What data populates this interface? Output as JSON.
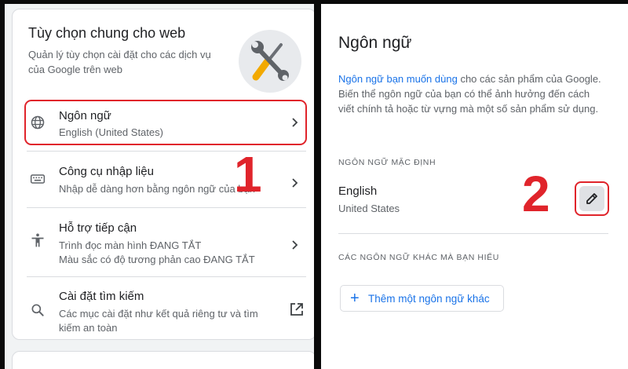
{
  "left": {
    "title": "Tùy chọn chung cho web",
    "subtitle": "Quản lý tùy chọn cài đặt cho các dịch vụ của Google trên web",
    "tools_icon": "wrench-screwdriver-icon",
    "items": [
      {
        "icon": "globe-icon",
        "title": "Ngôn ngữ",
        "desc": "English (United States)"
      },
      {
        "icon": "keyboard-icon",
        "title": "Công cụ nhập liệu",
        "desc": "Nhập dễ dàng hơn bằng ngôn ngữ của bạn"
      },
      {
        "icon": "accessibility-icon",
        "title": "Hỗ trợ tiếp cận",
        "desc": "Trình đọc màn hình ĐANG TẮT",
        "desc2": "Màu sắc có độ tương phản cao ĐANG TẮT"
      },
      {
        "icon": "search-icon",
        "title": "Cài đặt tìm kiếm",
        "desc": "Các mục cài đặt như kết quả riêng tư và tìm",
        "desc2": "kiếm an toàn"
      }
    ],
    "step": "1"
  },
  "right": {
    "title": "Ngôn ngữ",
    "desc_link": "Ngôn ngữ bạn muốn dùng",
    "desc_rest": " cho các sản phẩm của Google. Biến thể ngôn ngữ của bạn có thể ảnh hưởng đến cách viết chính tả hoặc từ vựng mà một số sản phẩm sử dụng.",
    "default_section": "NGÔN NGỮ MẶC ĐỊNH",
    "default_lang": "English",
    "default_region": "United States",
    "other_section": "CÁC NGÔN NGỮ KHÁC MÀ BẠN HIỂU",
    "add_label": "Thêm một ngôn ngữ khác",
    "step": "2"
  },
  "colors": {
    "accent": "#1a73e8",
    "highlight": "#e0242b"
  }
}
